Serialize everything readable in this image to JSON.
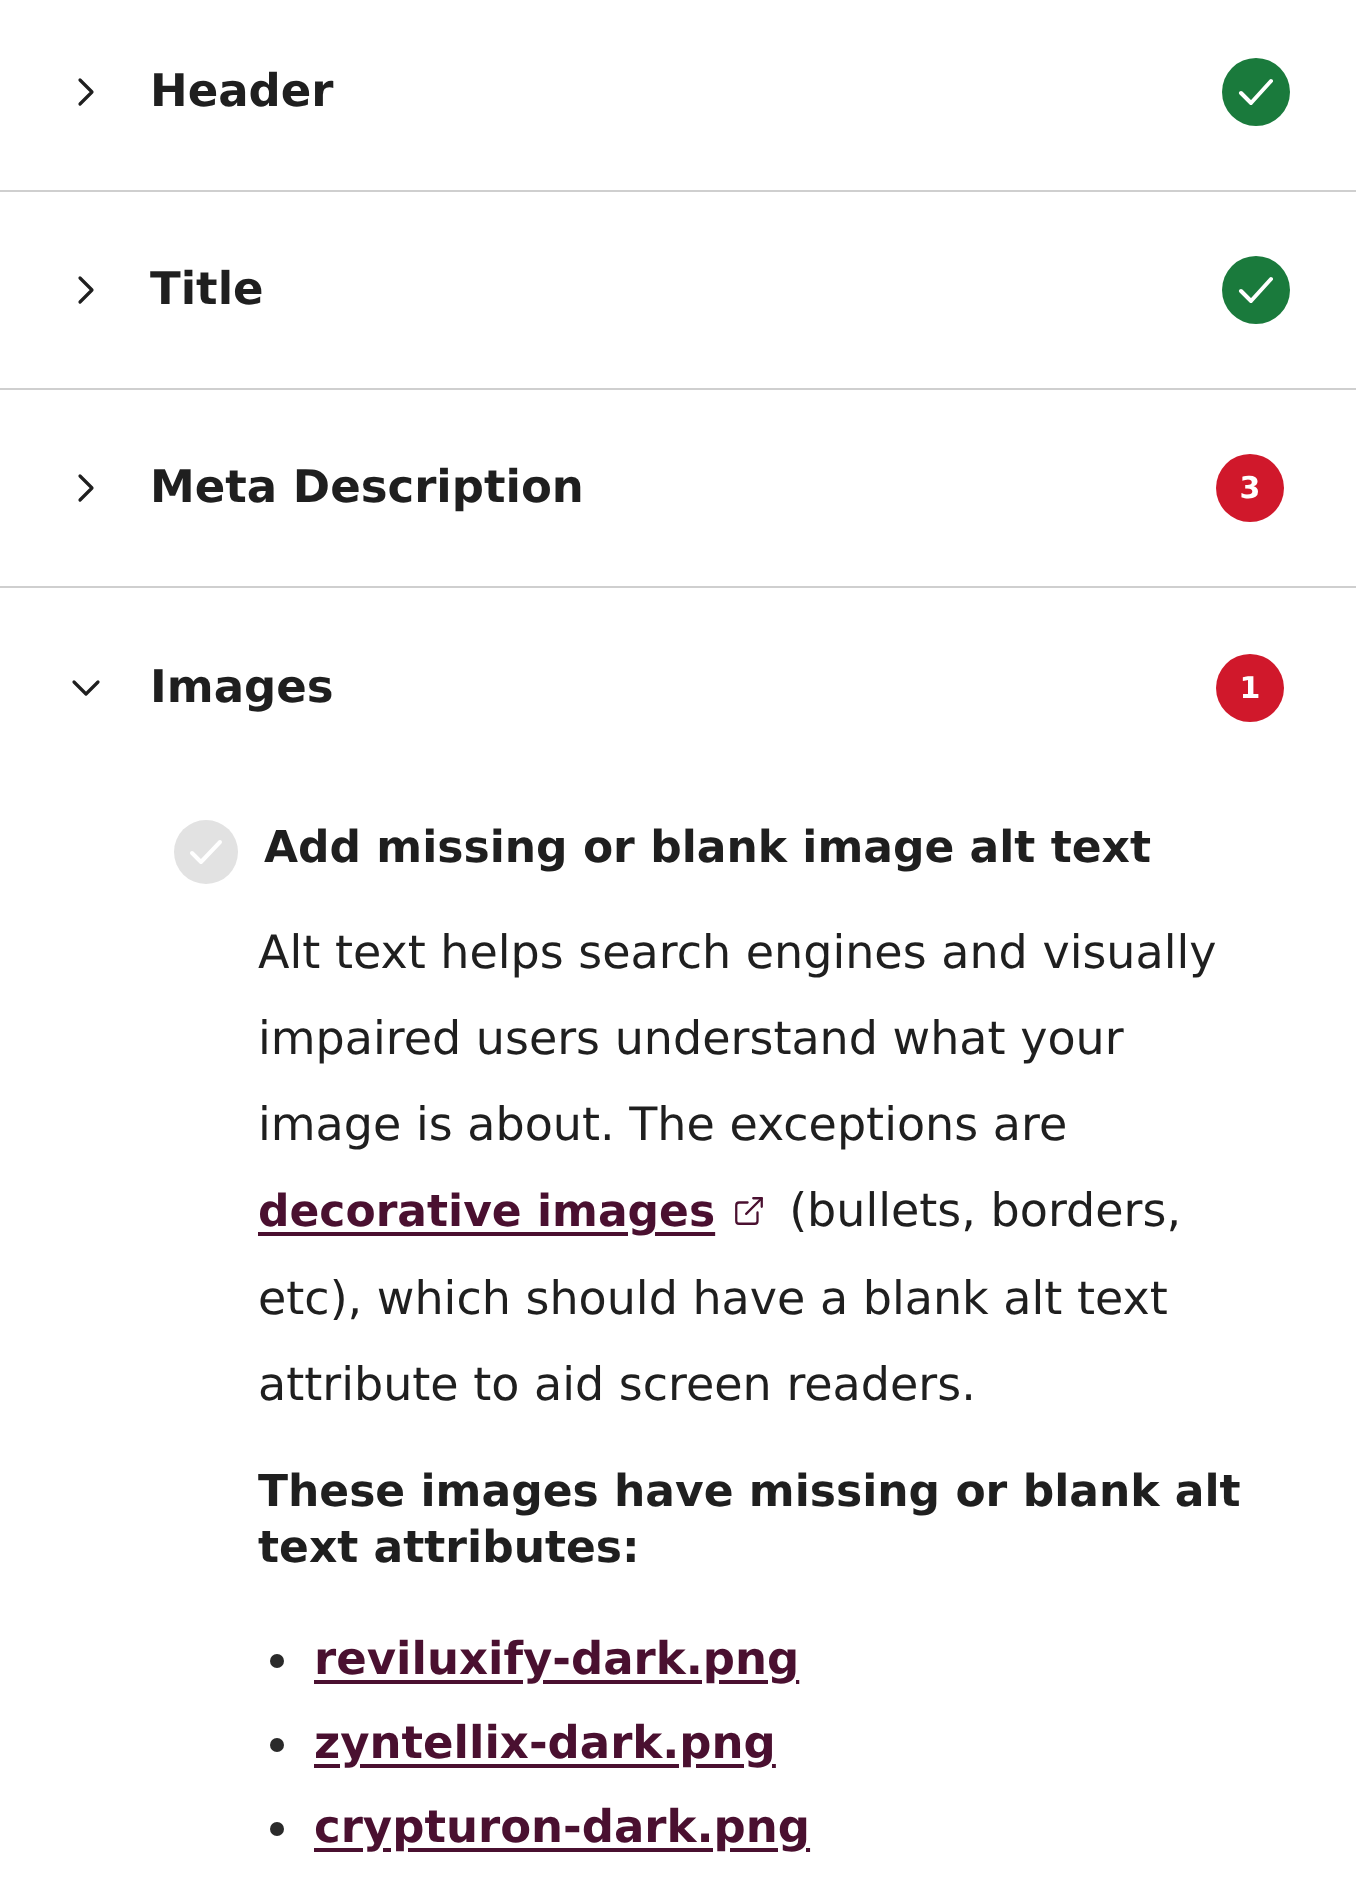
{
  "sections": [
    {
      "title": "Header",
      "expanded": false,
      "kind": "pass"
    },
    {
      "title": "Title",
      "expanded": false,
      "kind": "pass"
    },
    {
      "title": "Meta Description",
      "expanded": false,
      "kind": "issues",
      "count": "3"
    },
    {
      "title": "Images",
      "expanded": true,
      "kind": "issues",
      "count": "1",
      "checks": [
        {
          "title": "Add missing or blank image alt text",
          "done": false,
          "description": {
            "before": "Alt text helps search engines and visually impaired users understand what your image is about. The exceptions are",
            "link": "decorative images",
            "after": "(bullets, borders, etc), which should have a blank alt text attribute to aid screen readers."
          },
          "list_heading": "These images have missing or blank alt text attributes:",
          "images": [
            "reviluxify-dark.png",
            "zyntellix-dark.png",
            "crypturon-dark.png"
          ]
        }
      ]
    }
  ]
}
